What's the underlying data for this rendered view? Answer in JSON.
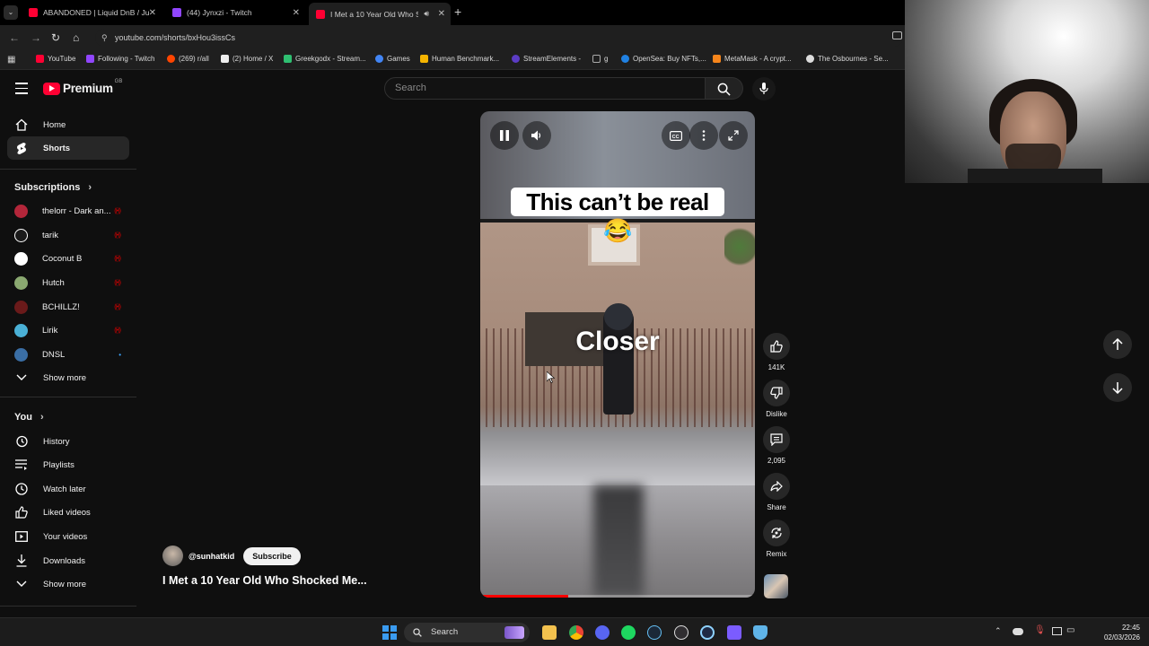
{
  "tabs": [
    {
      "title": "ABANDONED | Liquid DnB / Ju",
      "favicon_color": "#ff0033"
    },
    {
      "title": "(44) Jynxzi - Twitch",
      "favicon_color": "#9146ff"
    },
    {
      "title": "I Met a 10 Year Old Who Sh",
      "favicon_color": "#ff0033",
      "active": true
    }
  ],
  "address": {
    "url": "youtube.com/shorts/bxHou3issCs"
  },
  "bookmarks": [
    {
      "label": "YouTube",
      "color": "#ff0033"
    },
    {
      "label": "Following - Twitch",
      "color": "#9146ff"
    },
    {
      "label": "(269) r/all",
      "color": "#ff4500"
    },
    {
      "label": "(2) Home / X",
      "color": "#eeeeee"
    },
    {
      "label": "Greekgodx - Stream...",
      "color": "#2fbf71"
    },
    {
      "label": "Games",
      "color": "#4285f4"
    },
    {
      "label": "Human Benchmark...",
      "color": "#f5b400"
    },
    {
      "label": "StreamElements -",
      "color": "#5b3cc4"
    },
    {
      "label": "g",
      "color": "#888888"
    },
    {
      "label": "OpenSea: Buy NFTs,...",
      "color": "#2081e2"
    },
    {
      "label": "MetaMask - A crypt...",
      "color": "#f6851b"
    },
    {
      "label": "The Osbournes - Se...",
      "color": "#dddddd"
    }
  ],
  "header": {
    "logo_text": "Premium",
    "logo_region": "GB",
    "search_placeholder": "Search"
  },
  "sidebar": {
    "main": [
      {
        "label": "Home",
        "icon": "home-icon"
      },
      {
        "label": "Shorts",
        "icon": "shorts-icon",
        "active": true
      }
    ],
    "subscriptions_title": "Subscriptions",
    "subscriptions": [
      {
        "label": "thelorr - Dark an...",
        "color": "#b3263a",
        "live": "((•))"
      },
      {
        "label": "tarik",
        "color": "#ffffff",
        "live": "((•))"
      },
      {
        "label": "Coconut B",
        "color": "#ffffff",
        "live": "((•))"
      },
      {
        "label": "Hutch",
        "color": "#8aa870",
        "live": "((•))"
      },
      {
        "label": "BCHILLZ!",
        "color": "#6a1a1a",
        "live": "((•))"
      },
      {
        "label": "Lirik",
        "color": "#4ab0d6",
        "live": "((•))"
      },
      {
        "label": "DNSL",
        "color": "#3a6ea5",
        "live": "•"
      }
    ],
    "show_more_1": "Show more",
    "you_title": "You",
    "you": [
      {
        "label": "History",
        "icon": "history-icon"
      },
      {
        "label": "Playlists",
        "icon": "playlists-icon"
      },
      {
        "label": "Watch later",
        "icon": "watch-later-icon"
      },
      {
        "label": "Liked videos",
        "icon": "liked-videos-icon"
      },
      {
        "label": "Your videos",
        "icon": "your-videos-icon"
      },
      {
        "label": "Downloads",
        "icon": "downloads-icon"
      }
    ],
    "show_more_2": "Show more"
  },
  "player": {
    "caption": "This can’t be real 😂",
    "overlay_word": "Closer",
    "progress": 0.32
  },
  "actions": {
    "likes": "141K",
    "dislike": "Dislike",
    "comments": "2,095",
    "share": "Share",
    "remix": "Remix"
  },
  "channel": {
    "handle": "@sunhatkid",
    "subscribe": "Subscribe",
    "title": "I Met a 10 Year Old Who Shocked Me..."
  },
  "taskbar": {
    "search": "Search",
    "time": "22:45",
    "date": "02/03/2026"
  }
}
